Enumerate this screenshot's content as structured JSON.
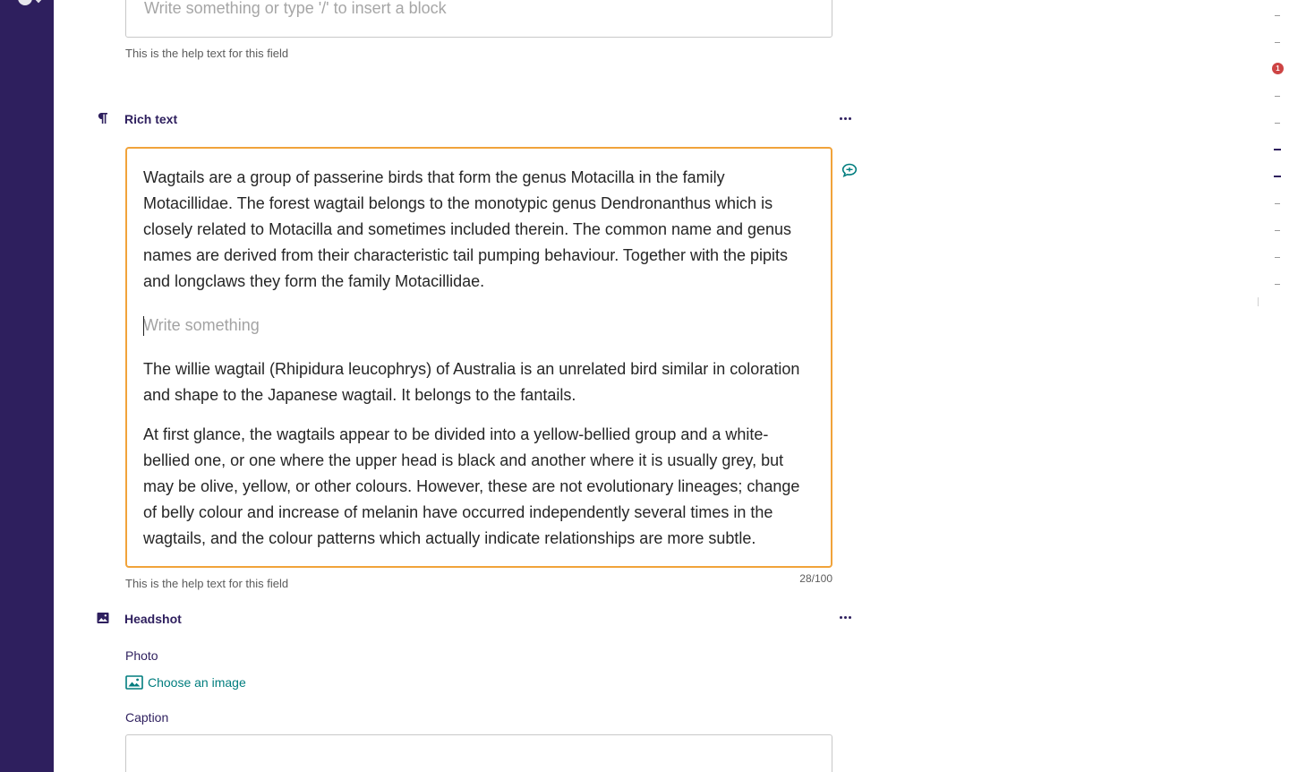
{
  "top_field": {
    "placeholder": "Write something or type '/' to insert a block",
    "help_text": "This is the help text for this field"
  },
  "rich_text_block": {
    "title": "Rich text",
    "icon": "pilcrow-icon",
    "paragraphs": [
      "Wagtails are a group of passerine birds that form the genus Motacilla in the family Motacillidae. The forest wagtail belongs to the monotypic genus Dendronanthus which is closely related to Motacilla and sometimes included therein. The common name and genus names are derived from their characteristic tail pumping behaviour. Together with the pipits and longclaws they form the family Motacillidae.",
      "The willie wagtail (Rhipidura leucophrys) of Australia is an unrelated bird similar in coloration and shape to the Japanese wagtail. It belongs to the fantails.",
      "At first glance, the wagtails appear to be divided into a yellow-bellied group and a white-bellied one, or one where the upper head is black and another where it is usually grey, but may be olive, yellow, or other colours. However, these are not evolutionary lineages; change of belly colour and increase of melanin have occurred independently several times in the wagtails, and the colour patterns which actually indicate relationships are more subtle."
    ],
    "empty_placeholder": "Write something",
    "help_text": "This is the help text for this field",
    "counter": "28/100",
    "focus_color": "#f1a33a"
  },
  "headshot_block": {
    "title": "Headshot",
    "icon": "image-icon",
    "photo_label": "Photo",
    "choose_image_label": "Choose an image",
    "caption_label": "Caption",
    "caption_value": ""
  },
  "minimap": {
    "error_count": "1",
    "error_color": "#cd4444"
  },
  "colors": {
    "sidebar": "#2e1f5e",
    "accent": "#007d7e",
    "label": "#2e1f5e"
  }
}
